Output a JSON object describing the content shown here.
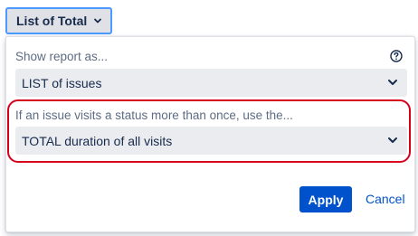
{
  "trigger": {
    "label": "List of Total",
    "icon": "chevron-down-icon"
  },
  "report": {
    "label": "Show report as...",
    "help_icon": "help-circle-icon",
    "select_value": "LIST of issues"
  },
  "visits": {
    "label": "If an issue visits a status more than once, use the...",
    "select_value": "TOTAL duration of all visits"
  },
  "actions": {
    "apply_label": "Apply",
    "cancel_label": "Cancel"
  },
  "colors": {
    "primary": "#0052cc",
    "focus_border": "#4c9aff",
    "highlight": "#d6001c",
    "select_bg": "#ebecf0"
  }
}
